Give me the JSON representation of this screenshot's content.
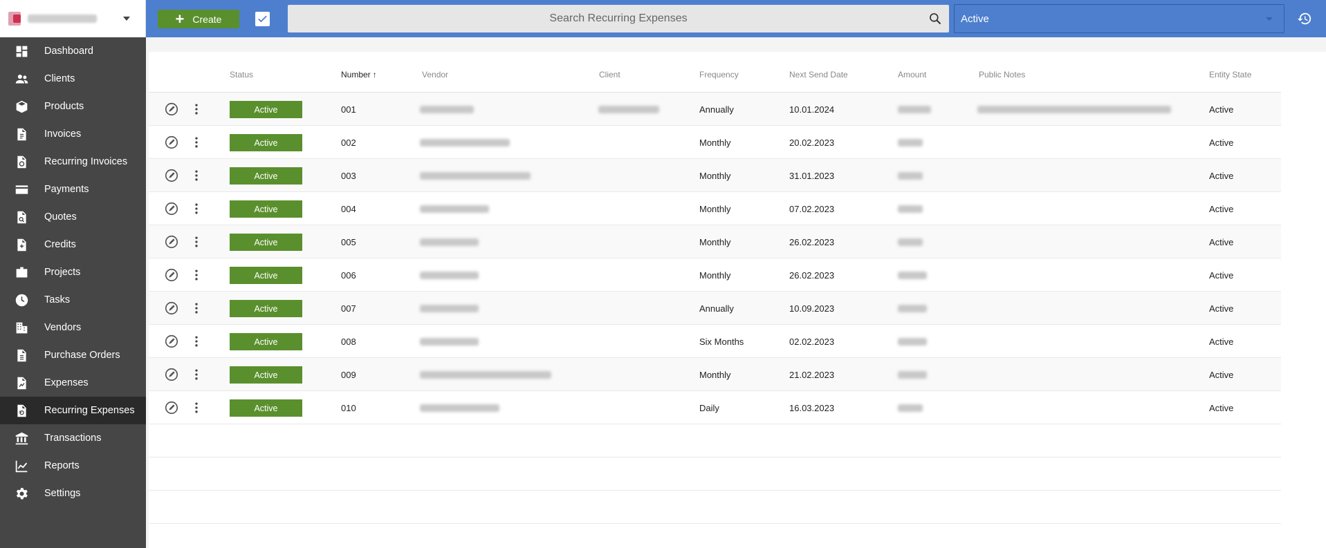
{
  "sidebar": {
    "items": [
      {
        "label": "Dashboard",
        "icon": "dashboard-icon",
        "active": false
      },
      {
        "label": "Clients",
        "icon": "clients-icon",
        "active": false
      },
      {
        "label": "Products",
        "icon": "products-icon",
        "active": false
      },
      {
        "label": "Invoices",
        "icon": "invoices-icon",
        "active": false
      },
      {
        "label": "Recurring Invoices",
        "icon": "recurring-invoices-icon",
        "active": false
      },
      {
        "label": "Payments",
        "icon": "payments-icon",
        "active": false
      },
      {
        "label": "Quotes",
        "icon": "quotes-icon",
        "active": false
      },
      {
        "label": "Credits",
        "icon": "credits-icon",
        "active": false
      },
      {
        "label": "Projects",
        "icon": "projects-icon",
        "active": false
      },
      {
        "label": "Tasks",
        "icon": "tasks-icon",
        "active": false
      },
      {
        "label": "Vendors",
        "icon": "vendors-icon",
        "active": false
      },
      {
        "label": "Purchase Orders",
        "icon": "purchase-orders-icon",
        "active": false
      },
      {
        "label": "Expenses",
        "icon": "expenses-icon",
        "active": false
      },
      {
        "label": "Recurring Expenses",
        "icon": "recurring-expenses-icon",
        "active": true
      },
      {
        "label": "Transactions",
        "icon": "transactions-icon",
        "active": false
      },
      {
        "label": "Reports",
        "icon": "reports-icon",
        "active": false
      },
      {
        "label": "Settings",
        "icon": "settings-icon",
        "active": false
      }
    ]
  },
  "toolbar": {
    "create_label": "Create",
    "search_placeholder": "Search Recurring Expenses",
    "state_filter": "Active"
  },
  "colors": {
    "topbar": "#4d7fce",
    "sidebar": "#464646",
    "status_active": "#5a8f2d"
  },
  "table": {
    "columns": [
      "Status",
      "Number",
      "Vendor",
      "Client",
      "Frequency",
      "Next Send Date",
      "Amount",
      "Public Notes",
      "Entity State"
    ],
    "sorted_column": "Number",
    "rows": [
      {
        "status": "Active",
        "number": "001",
        "frequency": "Annually",
        "next_send_date": "10.01.2024",
        "entity_state": "Active"
      },
      {
        "status": "Active",
        "number": "002",
        "frequency": "Monthly",
        "next_send_date": "20.02.2023",
        "entity_state": "Active"
      },
      {
        "status": "Active",
        "number": "003",
        "frequency": "Monthly",
        "next_send_date": "31.01.2023",
        "entity_state": "Active"
      },
      {
        "status": "Active",
        "number": "004",
        "frequency": "Monthly",
        "next_send_date": "07.02.2023",
        "entity_state": "Active"
      },
      {
        "status": "Active",
        "number": "005",
        "frequency": "Monthly",
        "next_send_date": "26.02.2023",
        "entity_state": "Active"
      },
      {
        "status": "Active",
        "number": "006",
        "frequency": "Monthly",
        "next_send_date": "26.02.2023",
        "entity_state": "Active"
      },
      {
        "status": "Active",
        "number": "007",
        "frequency": "Annually",
        "next_send_date": "10.09.2023",
        "entity_state": "Active"
      },
      {
        "status": "Active",
        "number": "008",
        "frequency": "Six Months",
        "next_send_date": "02.02.2023",
        "entity_state": "Active"
      },
      {
        "status": "Active",
        "number": "009",
        "frequency": "Monthly",
        "next_send_date": "21.02.2023",
        "entity_state": "Active"
      },
      {
        "status": "Active",
        "number": "010",
        "frequency": "Daily",
        "next_send_date": "16.03.2023",
        "entity_state": "Active"
      }
    ]
  }
}
